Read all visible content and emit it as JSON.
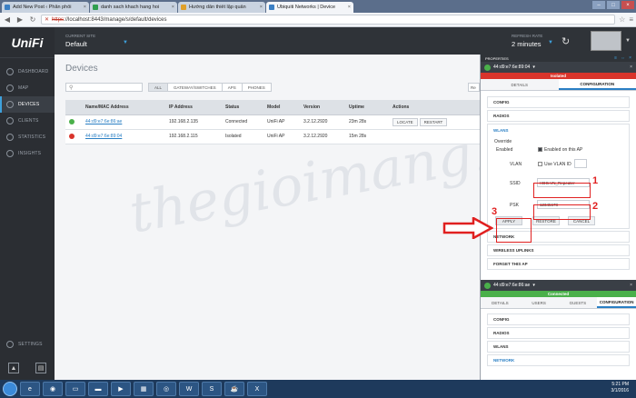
{
  "browser": {
    "tabs": [
      {
        "label": "Add New Post ‹ Phân phối",
        "color": "#3b7fc4"
      },
      {
        "label": "danh sach khach hang hoi",
        "color": "#2f9e4f"
      },
      {
        "label": "Hướng dẫn thiết lập quản",
        "color": "#e0a02a"
      },
      {
        "label": "Ubiquiti Networks | Device",
        "color": "#3b7fc4"
      }
    ],
    "url_scheme": "https",
    "url_rest": "://localhost:8443/manage/s/default/devices"
  },
  "sidebar": {
    "logo": "UniFi",
    "items": [
      {
        "label": "DASHBOARD"
      },
      {
        "label": "MAP"
      },
      {
        "label": "DEVICES"
      },
      {
        "label": "CLIENTS"
      },
      {
        "label": "STATISTICS"
      },
      {
        "label": "INSIGHTS"
      }
    ],
    "settings": "SETTINGS"
  },
  "header": {
    "site_label": "CURRENT SITE",
    "site_value": "Default",
    "refresh_label": "REFRESH RATE",
    "refresh_value": "2 minutes"
  },
  "main": {
    "title": "Devices",
    "filters": [
      "ALL",
      "GATEWAY/SWITCHES",
      "APS",
      "PHONES"
    ],
    "cut_button": "Re",
    "columns": [
      "",
      "Name/MAC Address",
      "IP Address",
      "Status",
      "Model",
      "Version",
      "Uptime",
      "Actions"
    ],
    "rows": [
      {
        "mac": "44:d9:e7:6e:86:ae",
        "ip": "192.168.2.135",
        "status": "Connected",
        "model": "UniFi AP",
        "version": "3.2.12.2920",
        "uptime": "23m 28s",
        "dot_color": "#4ab04a"
      },
      {
        "mac": "44:d9:e7:6e:89:04",
        "ip": "192.168.2.115",
        "status": "Isolated",
        "model": "UniFi AP",
        "version": "3.2.12.2920",
        "uptime": "15m 28s",
        "dot_color": "#d9342b"
      }
    ],
    "actions": {
      "locate": "LOCATE",
      "restart": "RESTART"
    }
  },
  "watermark": "thegioimang.vn",
  "properties": {
    "title": "PROPERTIES",
    "device1": {
      "mac": "44:d9:e7:6e:89:04",
      "status": "Isolated",
      "tabs": [
        "DETAILS",
        "CONFIGURATION"
      ],
      "sections": [
        "CONFIG",
        "RADIOS"
      ],
      "wlans": {
        "title": "WLANS",
        "override": "Override",
        "enabled_label": "Enabled",
        "enabled_value": "Enabled on this AP",
        "vlan_label": "VLAN",
        "vlan_value": "Use VLAN ID",
        "ssid_label": "SSID",
        "ssid_value": "HDG.VN_Repeater",
        "psk_label": "PSK",
        "psk_value": "12345678",
        "apply": "APPLY",
        "restore": "RESTORE",
        "cancel": "CANCEL"
      },
      "sections_after": [
        "NETWORK",
        "WIRELESS UPLINKS",
        "FORGET THIS AP"
      ]
    },
    "device2": {
      "mac": "44:d9:e7:6e:86:ae",
      "status": "Connected",
      "tabs": [
        "DETAILS",
        "USERS",
        "GUESTS",
        "CONFIGURATION"
      ],
      "sections": [
        "CONFIG",
        "RADIOS",
        "WLANS",
        "NETWORK"
      ]
    }
  },
  "annotations": [
    "1",
    "2",
    "3"
  ],
  "taskbar": {
    "time": "5:21 PM",
    "date": "3/1/2016"
  },
  "colors": {
    "accent": "#2a7fc4",
    "connected": "#4ab04a",
    "isolated": "#d9342b",
    "annotation": "#e02020"
  }
}
